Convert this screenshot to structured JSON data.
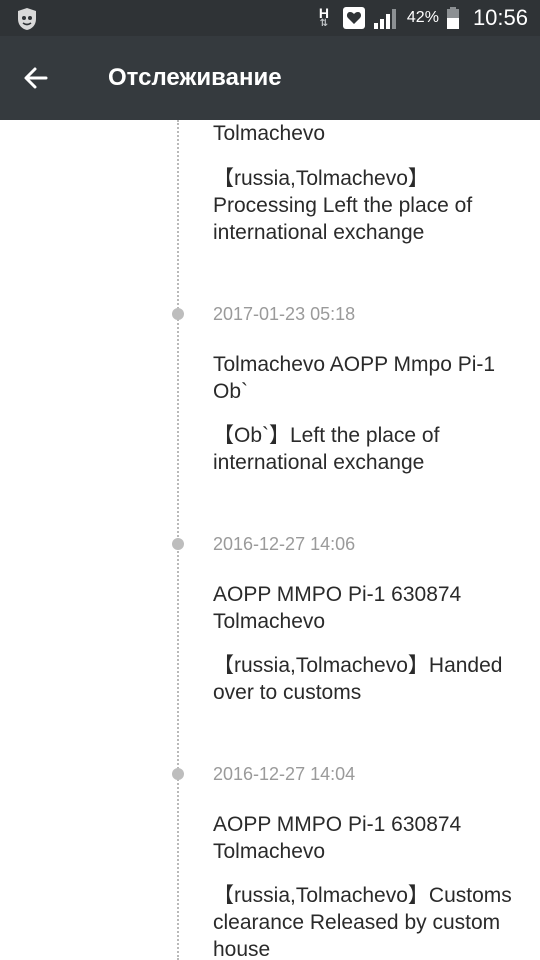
{
  "status_bar": {
    "battery_percent": "42%",
    "time": "10:56",
    "network_letter": "H",
    "network_arrows": "⇅",
    "icons": [
      "app-notification-icon",
      "network-h-icon",
      "favorite-notification-icon",
      "signal-icon",
      "battery-icon"
    ]
  },
  "app_bar": {
    "title": "Отслеживание",
    "back_icon": "arrow-back-icon"
  },
  "events": [
    {
      "date": "",
      "location": "Tolmachevo",
      "detail": "【russia,Tolmachevo】Processing Left the place of international exchange"
    },
    {
      "date": "2017-01-23 05:18",
      "location": "Tolmachevo AOPP Mmpo Pi-1 Ob`",
      "detail": "【Ob`】Left the place of international exchange"
    },
    {
      "date": "2016-12-27 14:06",
      "location": "AOPP MMPO Pi-1 630874 Tolmachevo",
      "detail": "【russia,Tolmachevo】Handed over to customs"
    },
    {
      "date": "2016-12-27 14:04",
      "location": "AOPP MMPO Pi-1 630874 Tolmachevo",
      "detail": "【russia,Tolmachevo】Customs clearance Released by custom house"
    }
  ]
}
